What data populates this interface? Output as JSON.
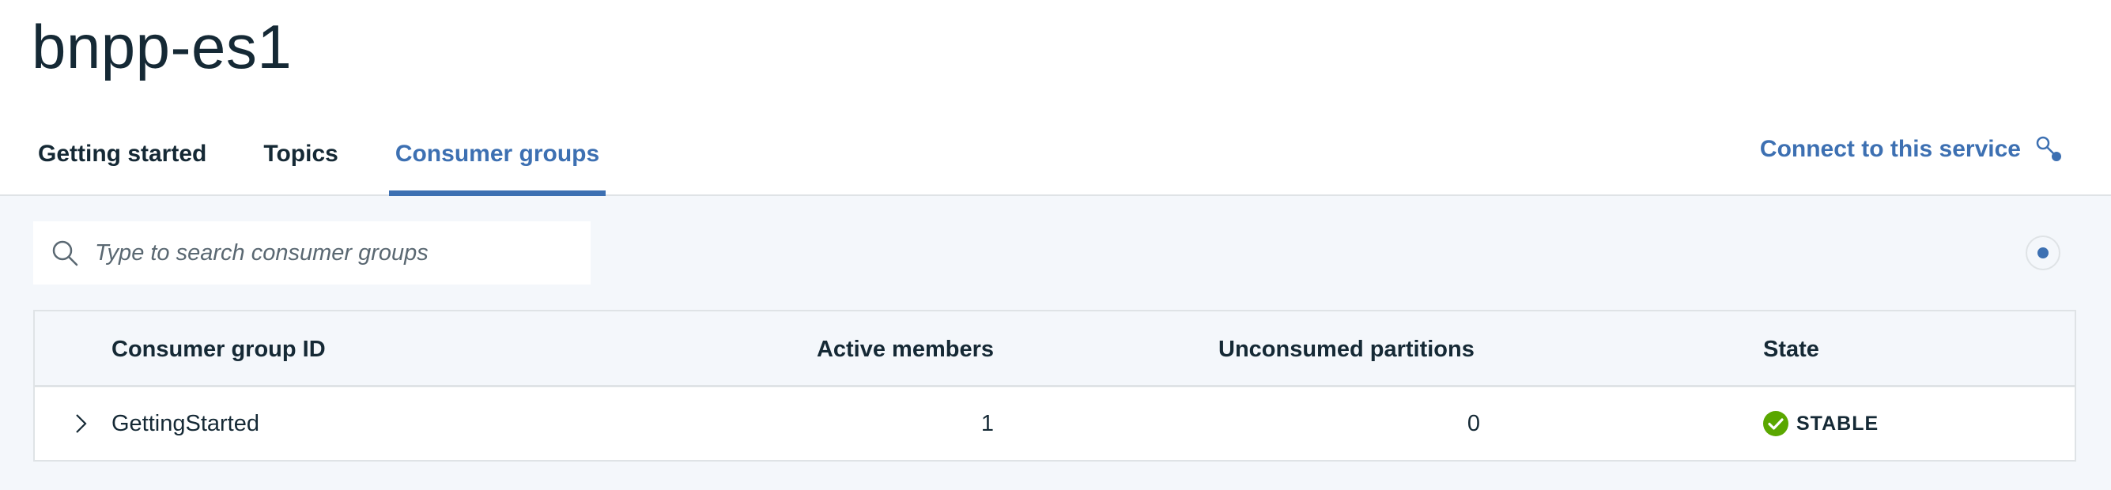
{
  "header": {
    "title": "bnpp-es1",
    "connect_label": "Connect to this service",
    "connect_icon": "key-icon"
  },
  "tabs": [
    {
      "label": "Getting started",
      "active": false
    },
    {
      "label": "Topics",
      "active": false
    },
    {
      "label": "Consumer groups",
      "active": true
    }
  ],
  "search": {
    "placeholder": "Type to search consumer groups",
    "value": "",
    "icon": "search-icon"
  },
  "table": {
    "columns": [
      "Consumer group ID",
      "Active members",
      "Unconsumed partitions",
      "State"
    ],
    "rows": [
      {
        "id": "GettingStarted",
        "active_members": "1",
        "unconsumed_partitions": "0",
        "state": "STABLE"
      }
    ]
  },
  "colors": {
    "accent": "#3d70b2",
    "text": "#152935",
    "content_bg": "#f4f7fb",
    "status_ok": "#5aa700"
  }
}
